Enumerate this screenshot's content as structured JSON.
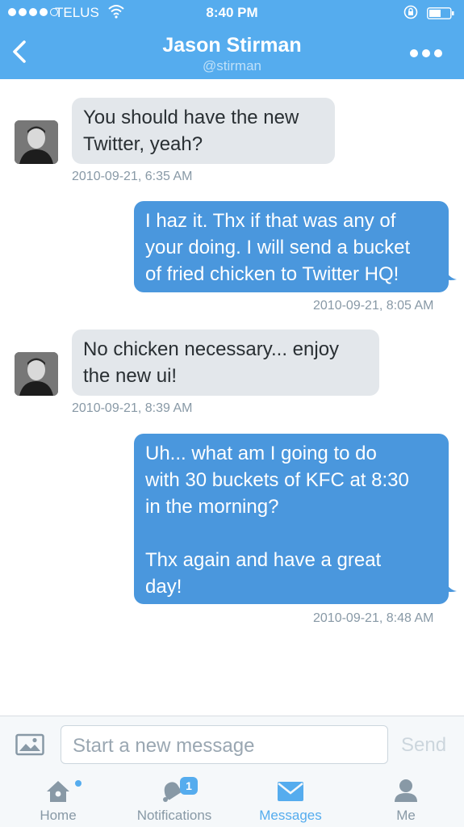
{
  "status_bar": {
    "carrier": "TELUS",
    "time": "8:40 PM"
  },
  "header": {
    "name": "Jason Stirman",
    "handle": "@stirman"
  },
  "messages": [
    {
      "direction": "incoming",
      "text": "You should have the new\nTwitter, yeah?",
      "timestamp": "2010-09-21, 6:35 AM"
    },
    {
      "direction": "outgoing",
      "text": "I haz it.  Thx if that was any of\nyour doing. I will send a bucket\nof fried chicken to Twitter HQ!",
      "timestamp": "2010-09-21, 8:05 AM"
    },
    {
      "direction": "incoming",
      "text": "No chicken necessary... enjoy\nthe new ui!",
      "timestamp": "2010-09-21, 8:39 AM"
    },
    {
      "direction": "outgoing",
      "text": "Uh... what am I going to do\nwith 30 buckets of KFC at 8:30\nin the morning?\n\nThx again and have a great\nday!",
      "timestamp": "2010-09-21, 8:48 AM"
    }
  ],
  "compose": {
    "placeholder": "Start a new message",
    "send_label": "Send"
  },
  "tabs": [
    {
      "label": "Home",
      "icon": "home-icon",
      "active": false
    },
    {
      "label": "Notifications",
      "icon": "bell-icon",
      "badge": "1",
      "active": false
    },
    {
      "label": "Messages",
      "icon": "envelope-icon",
      "active": true
    },
    {
      "label": "Me",
      "icon": "person-icon",
      "active": false
    }
  ],
  "colors": {
    "brand": "#55acee",
    "outgoing_bubble": "#4a97dd",
    "incoming_bubble": "#e3e7eb"
  }
}
